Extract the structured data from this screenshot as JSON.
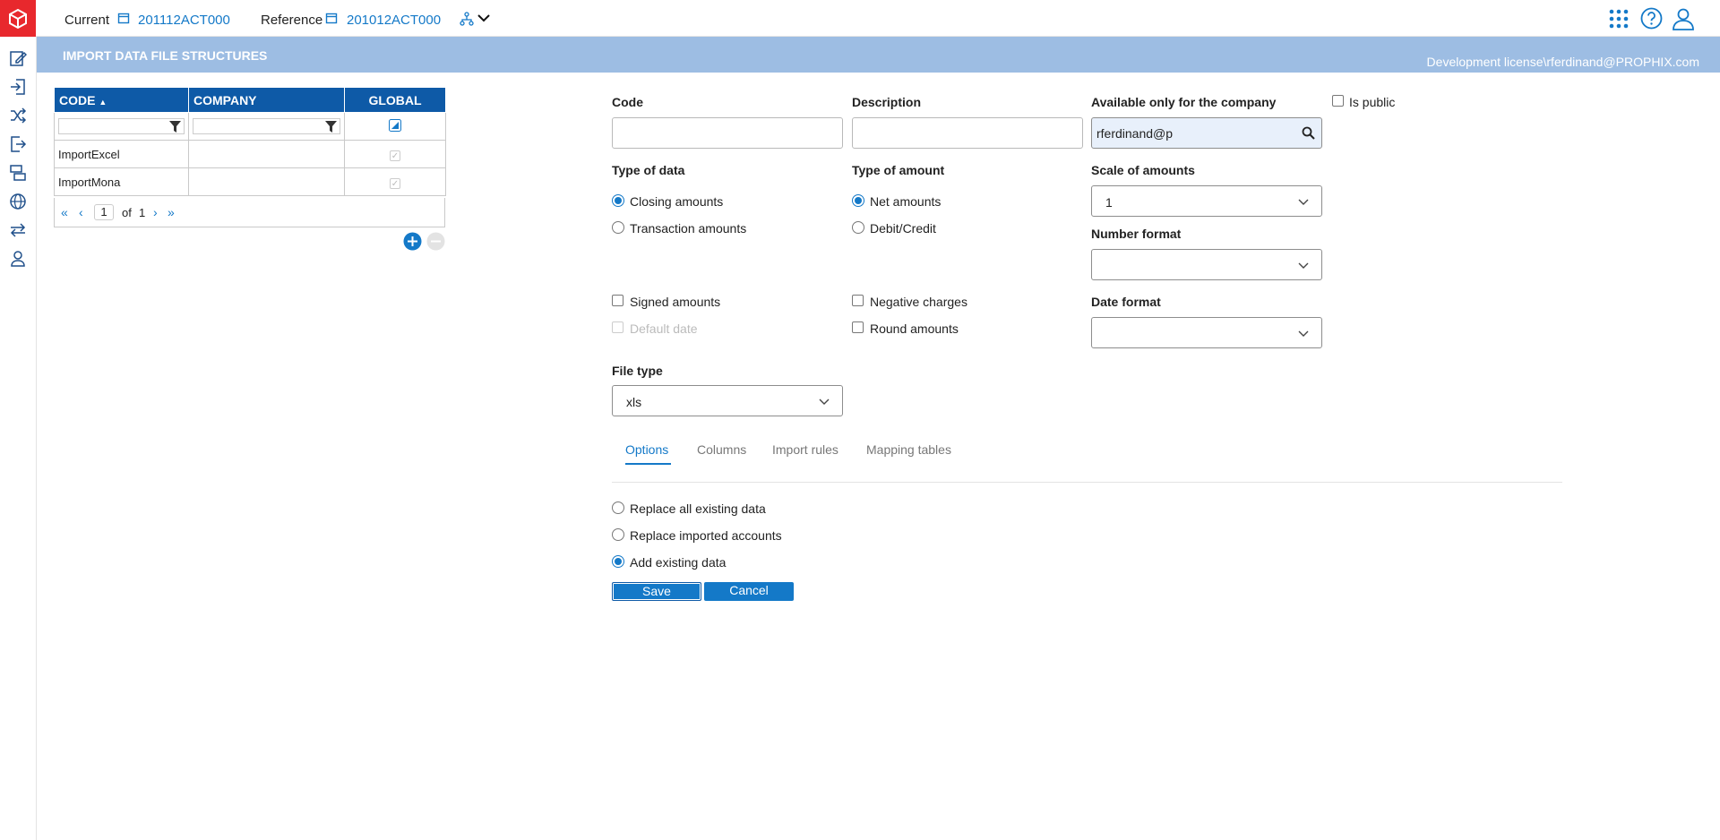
{
  "topbar": {
    "current_label": "Current",
    "current_value": "201112ACT000",
    "reference_label": "Reference",
    "reference_value": "201012ACT000"
  },
  "banner": {
    "title": "Import data file structures",
    "license": "Development license\\rferdinand@PROPHIX.com"
  },
  "grid": {
    "headers": [
      "CODE",
      "COMPANY",
      "GLOBAL"
    ],
    "rows": [
      {
        "code": "ImportExcel",
        "company": "",
        "global": true
      },
      {
        "code": "ImportMona",
        "company": "",
        "global": true
      }
    ],
    "pager": {
      "page": "1",
      "of_label": "of",
      "total": "1"
    }
  },
  "form": {
    "code_label": "Code",
    "code_value": "",
    "description_label": "Description",
    "description_value": "",
    "company_label": "Available only for the company",
    "company_value": "rferdinand@p",
    "is_public_label": "Is public",
    "type_of_data_label": "Type of data",
    "closing_label": "Closing amounts",
    "transaction_label": "Transaction amounts",
    "type_of_amount_label": "Type of amount",
    "net_label": "Net amounts",
    "debit_label": "Debit/Credit",
    "scale_label": "Scale of amounts",
    "scale_value": "1",
    "number_format_label": "Number format",
    "number_format_value": "",
    "signed_label": "Signed amounts",
    "default_date_label": "Default date",
    "negative_label": "Negative charges",
    "round_label": "Round amounts",
    "date_format_label": "Date format",
    "date_format_value": "",
    "file_type_label": "File type",
    "file_type_value": "xls"
  },
  "tabs": [
    "Options",
    "Columns",
    "Import rules",
    "Mapping tables"
  ],
  "options": {
    "replace_all": "Replace all existing data",
    "replace_imported": "Replace imported accounts",
    "add_existing": "Add existing data"
  },
  "buttons": {
    "save": "Save",
    "cancel": "Cancel"
  },
  "colors": {
    "accent": "#1479c8",
    "header": "#0e5aa7",
    "banner": "#9dbde3",
    "logo": "#e8282d"
  }
}
